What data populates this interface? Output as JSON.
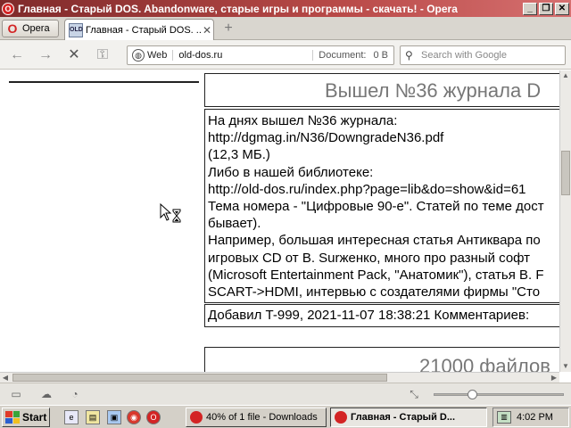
{
  "window": {
    "title": "Главная - Старый DOS. Abandonware, старые игры и программы - скачать! - Opera",
    "controls": {
      "minimize": "_",
      "restore": "❐",
      "close": "✕"
    }
  },
  "tabs": {
    "menu_label": "Opera",
    "active_tab": {
      "title": "Главная - Старый DOS. ...",
      "favicon_text": "OLD"
    },
    "close_symbol": "✕",
    "new_tab_symbol": "+"
  },
  "navigation": {
    "back": "←",
    "forward": "→",
    "stop": "✕",
    "key": "⚿",
    "address": {
      "mode_label": "Web",
      "url": "old-dos.ru",
      "document_label": "Document:",
      "document_size": "0 B"
    },
    "search": {
      "placeholder": "Search with Google"
    }
  },
  "content": {
    "article": {
      "title": "Вышел №36 журнала D",
      "lines": [
        "На днях вышел №36 журнала:",
        "http://dgmag.in/N36/DowngradeN36.pdf",
        "(12,3 МБ.)",
        "Либо в нашей библиотеке:",
        "http://old-dos.ru/index.php?page=lib&do=show&id=61",
        "Тема номера - \"Цифровые 90-е\". Статей по теме дост",
        "бывает).",
        "Например, большая интересная статья Антиквара по",
        "игровых CD от В. Surженко, много про разный софт",
        "(Microsoft Entertainment Pack, \"Анатомик\"), статья В. F",
        "SCART->HDMI, интервью с создателями фирмы \"Сто"
      ],
      "footer": "Добавил T-999, 2021-11-07 18:38:21 Комментариев:"
    },
    "next_title": "21000 файлов"
  },
  "status_bar": {
    "zoom_fraction": 0.28
  },
  "taskbar": {
    "start_label": "Start",
    "tasks": [
      {
        "label": "40% of 1 file - Downloads",
        "active": false
      },
      {
        "label": "Главная - Старый D...",
        "active": true
      }
    ],
    "clock": "4:02 PM"
  },
  "colors": {
    "titlebar": "#b94a48",
    "opera_red": "#d32424",
    "taskbar": "#d4d0c8"
  }
}
